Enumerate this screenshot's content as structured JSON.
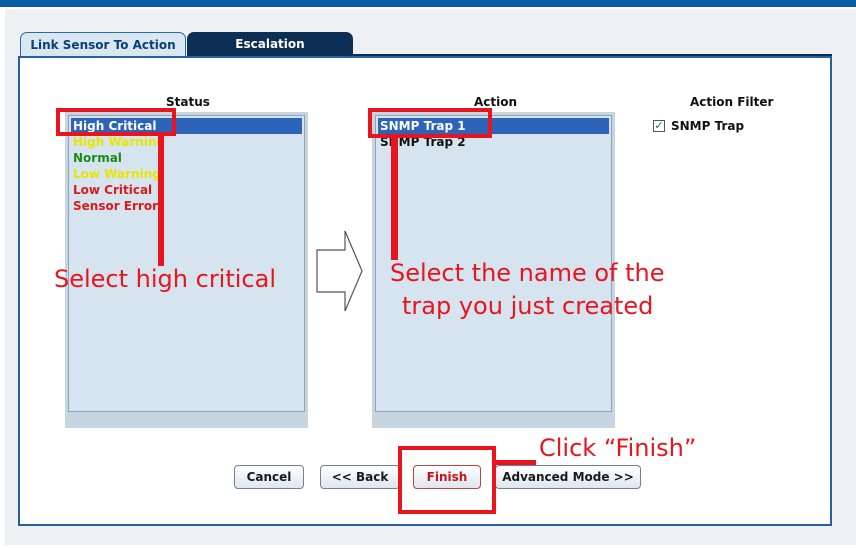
{
  "tabs": [
    {
      "label": "Link Sensor To Action",
      "active": true
    },
    {
      "label": "Escalation",
      "active": false
    }
  ],
  "status": {
    "heading": "Status",
    "items": [
      {
        "label": "High Critical",
        "color": "#ffffff",
        "selected": true
      },
      {
        "label": "High Warning",
        "color": "#e6e600",
        "selected": false
      },
      {
        "label": "Normal",
        "color": "#1a8a1a",
        "selected": false
      },
      {
        "label": "Low Warning",
        "color": "#e6e600",
        "selected": false
      },
      {
        "label": "Low Critical",
        "color": "#d81b1b",
        "selected": false
      },
      {
        "label": "Sensor Error",
        "color": "#d81b1b",
        "selected": false
      }
    ]
  },
  "action": {
    "heading": "Action",
    "items": [
      {
        "label": "SNMP Trap 1",
        "selected": true
      },
      {
        "label": "SNMP Trap 2",
        "selected": false
      }
    ]
  },
  "filter": {
    "heading": "Action Filter",
    "option_label": "SNMP Trap",
    "checked": true
  },
  "buttons": {
    "cancel": "Cancel",
    "back": "<< Back",
    "finish": "Finish",
    "advanced": "Advanced Mode >>"
  },
  "annotations": {
    "select_status": "Select high critical",
    "select_trap_line1": "Select the name of the",
    "select_trap_line2": "trap you just created",
    "click_finish": "Click “Finish”"
  },
  "colors": {
    "accent": "#0b5ca8",
    "selection": "#2d63b8",
    "annotation": "#e8141e"
  }
}
